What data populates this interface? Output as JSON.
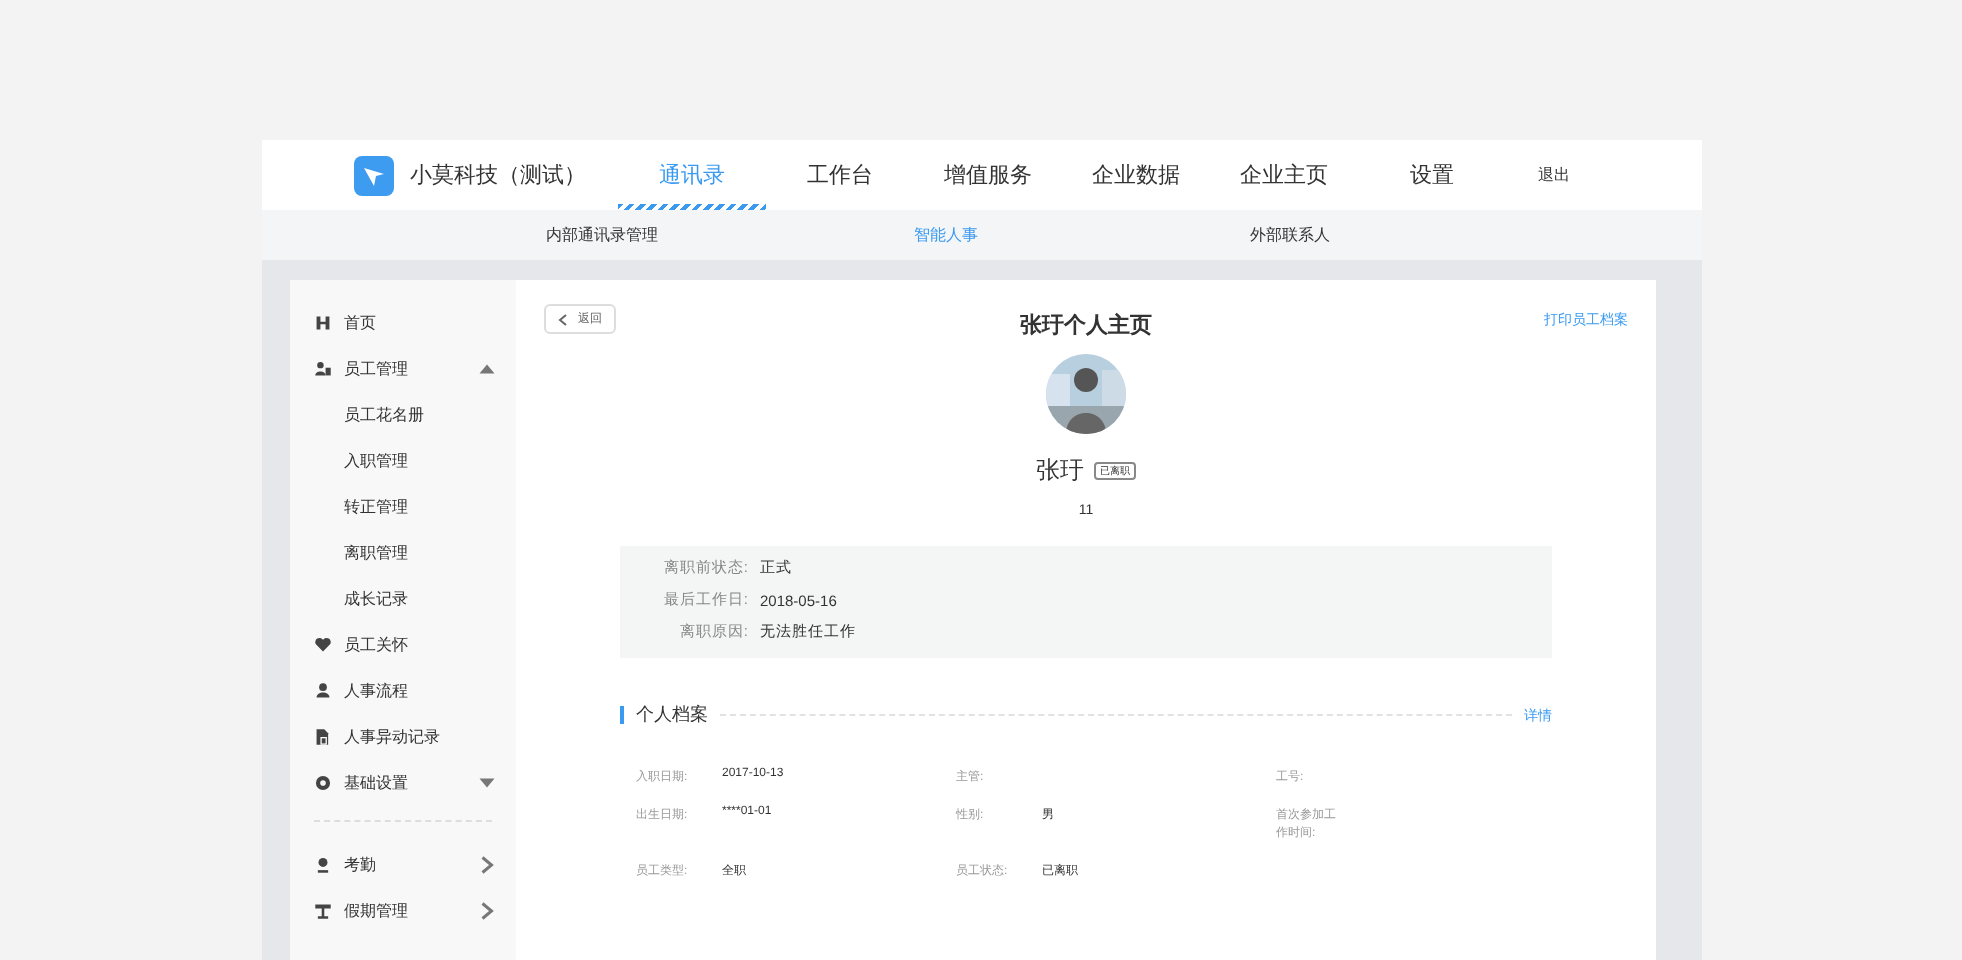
{
  "brand": {
    "name": "小莫科技（测试）"
  },
  "nav": [
    {
      "label": "通讯录",
      "selected": true
    },
    {
      "label": "工作台",
      "selected": false
    },
    {
      "label": "增值服务",
      "selected": false
    },
    {
      "label": "企业数据",
      "selected": false
    },
    {
      "label": "企业主页",
      "selected": false
    },
    {
      "label": "设置",
      "selected": false
    }
  ],
  "logout": "退出",
  "subnav": [
    {
      "label": "内部通讯录管理",
      "selected": false
    },
    {
      "label": "智能人事",
      "selected": true
    },
    {
      "label": "外部联系人",
      "selected": false
    }
  ],
  "sidebar": {
    "sections": [
      [
        {
          "label": "首页"
        },
        {
          "label": "员工管理",
          "expanded": true,
          "children": [
            {
              "label": "员工花名册"
            },
            {
              "label": "入职管理"
            },
            {
              "label": "转正管理"
            },
            {
              "label": "离职管理"
            },
            {
              "label": "成长记录"
            }
          ]
        },
        {
          "label": "员工关怀"
        },
        {
          "label": "人事流程"
        },
        {
          "label": "人事异动记录"
        },
        {
          "label": "基础设置",
          "expanded": false
        }
      ],
      [
        {
          "label": "考勤",
          "kind": "link"
        },
        {
          "label": "假期管理",
          "kind": "link"
        }
      ]
    ]
  },
  "profile": {
    "back": "返回",
    "title": "张玗个人主页",
    "print": "打印员工档案",
    "name": "张玗",
    "status_badge": "已离职",
    "sub": "11",
    "leave_info": [
      {
        "label": "离职前状态:",
        "value": "正式"
      },
      {
        "label": "最后工作日:",
        "value": "2018-05-16"
      },
      {
        "label": "离职原因:",
        "value": "无法胜任工作"
      }
    ]
  },
  "section": {
    "title": "个人档案",
    "link": "详情",
    "fields": [
      {
        "label": "入职日期:",
        "value": "2017-10-13"
      },
      {
        "label": "主管:"
      },
      {
        "label": "工号:"
      },
      {
        "label": "出生日期:",
        "value": "****01-01"
      },
      {
        "label": "性别:",
        "value": "男"
      },
      {
        "label": "首次参加工作时间:"
      },
      {
        "label": "员工类型:",
        "value": "全职"
      },
      {
        "label": "员工状态:",
        "value": "已离职"
      }
    ]
  }
}
